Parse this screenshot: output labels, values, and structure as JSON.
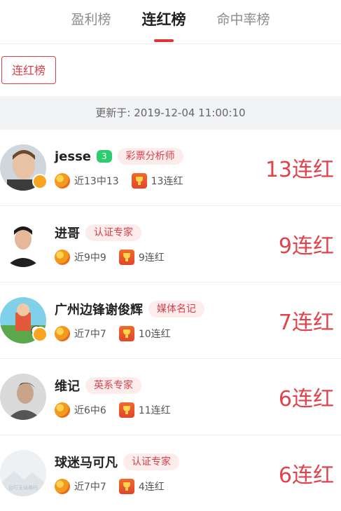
{
  "tabs": [
    {
      "label": "盈利榜",
      "active": false
    },
    {
      "label": "连红榜",
      "active": true
    },
    {
      "label": "命中率榜",
      "active": false
    }
  ],
  "filter": {
    "label": "连红榜"
  },
  "update_text": "更新于: 2019-12-04 11:00:10",
  "rows": [
    {
      "name": "jesse",
      "level": "3",
      "tag": "彩票分析师",
      "hit": "近13中13",
      "streak_small": "13连红",
      "streak": "13连红"
    },
    {
      "name": "进哥",
      "tag": "认证专家",
      "hit": "近9中9",
      "streak_small": "9连红",
      "streak": "9连红"
    },
    {
      "name": "广州边锋谢俊辉",
      "tag": "媒体名记",
      "hit": "近7中7",
      "streak_small": "10连红",
      "streak": "7连红"
    },
    {
      "name": "维记",
      "tag": "英系专家",
      "hit": "近6中6",
      "streak_small": "11连红",
      "streak": "6连红"
    },
    {
      "name": "球迷马可凡",
      "tag": "认证专家",
      "hit": "近7中7",
      "streak_small": "4连红",
      "streak": "6连红",
      "avatar_text": "台叮无误桑吗"
    }
  ],
  "colors": {
    "accent": "#e0343a",
    "level_green": "#2ecc71",
    "tag_bg": "#fdecec"
  }
}
